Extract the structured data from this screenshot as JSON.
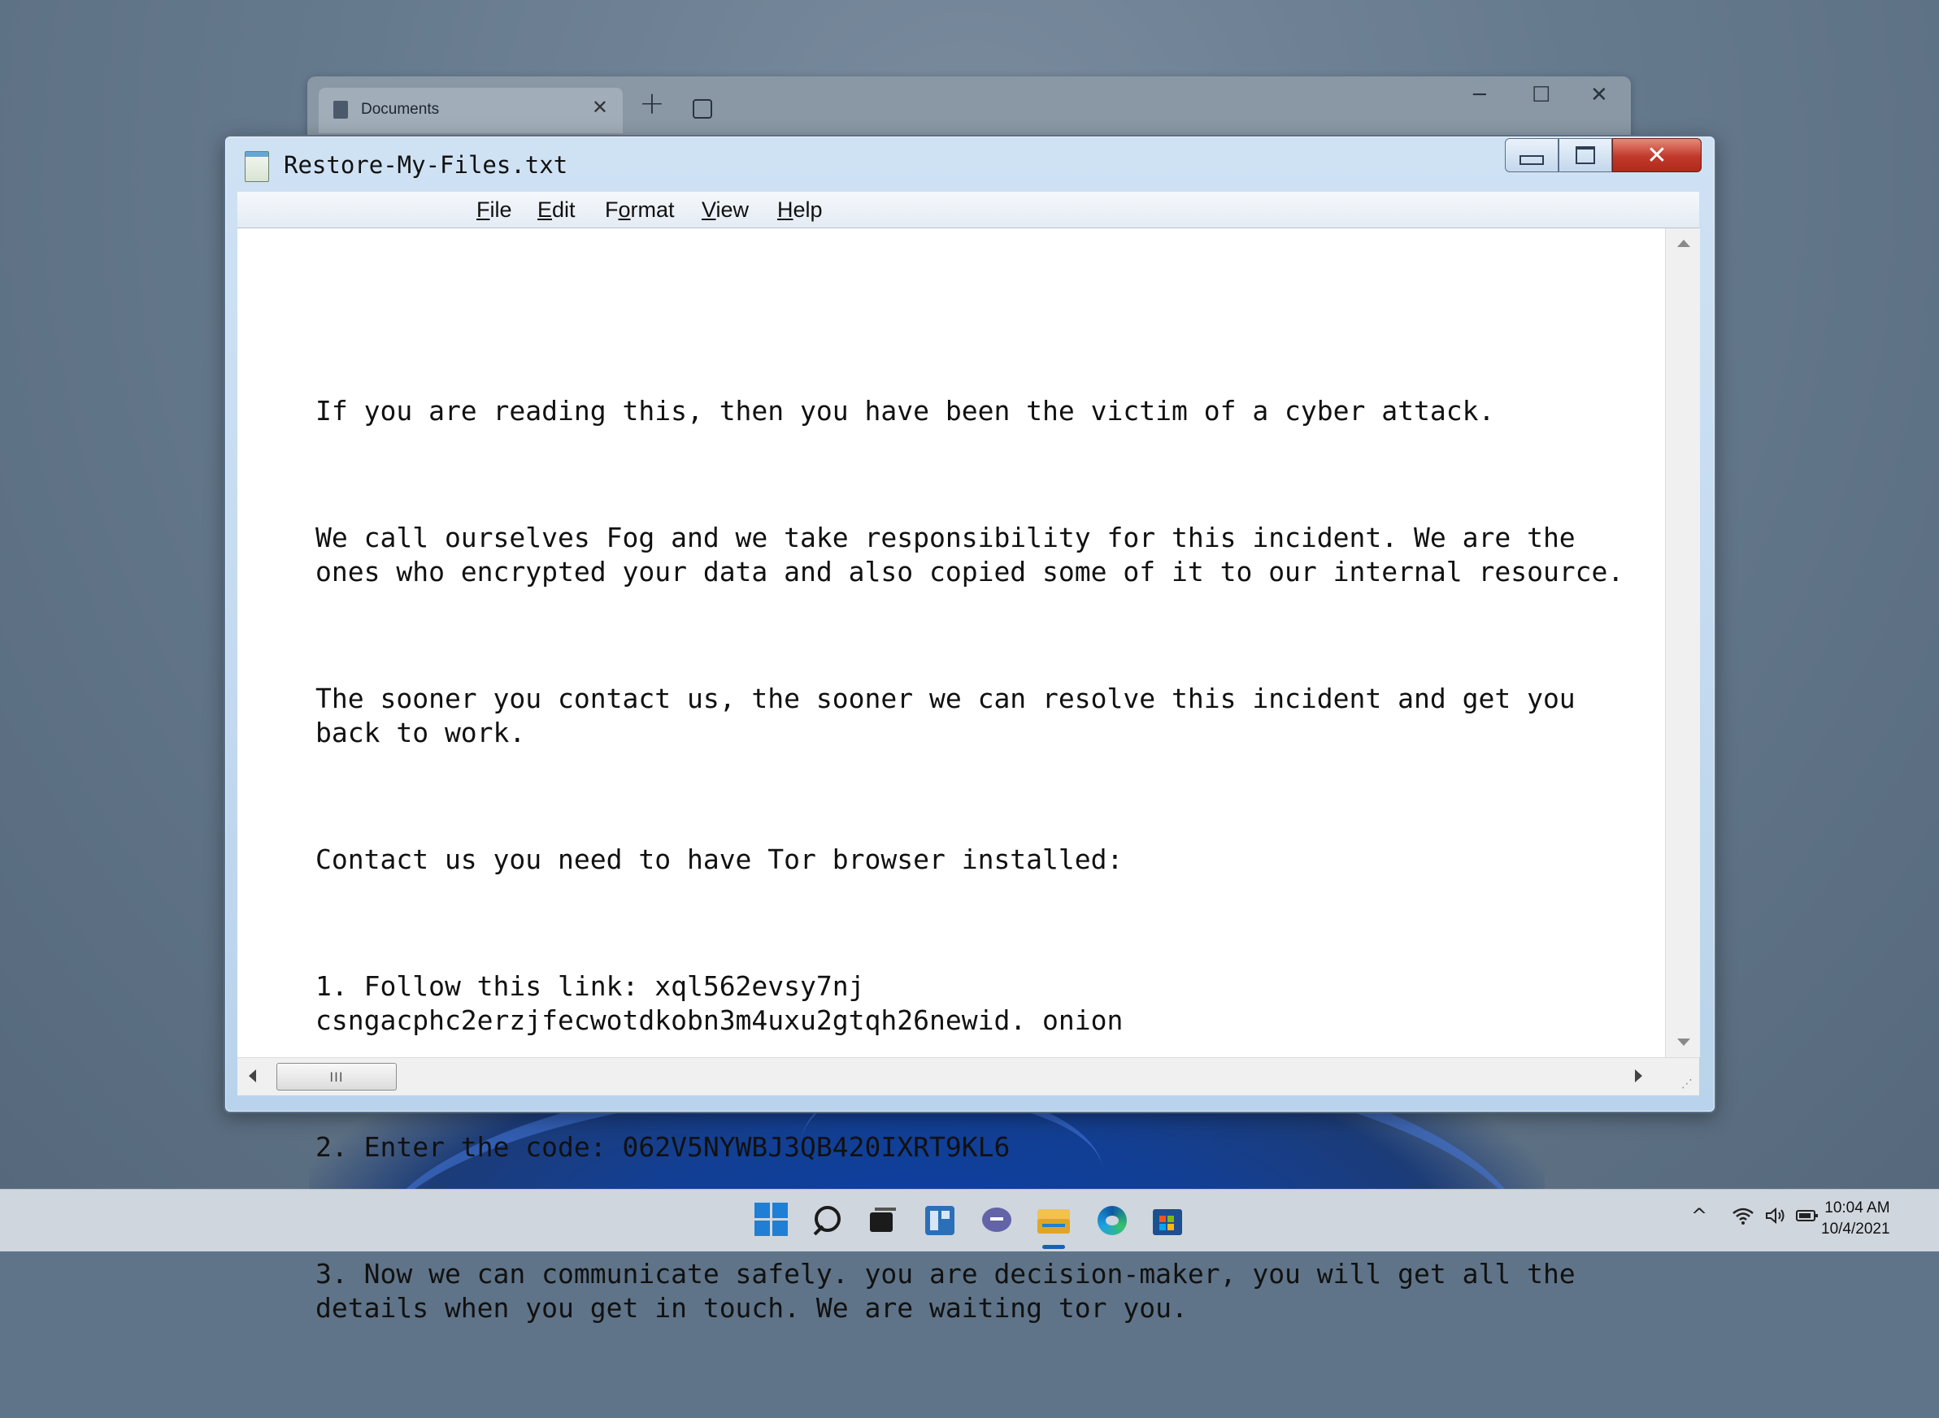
{
  "explorer": {
    "tab_label": "Documents",
    "tab_close": "✕",
    "new_tab": "+",
    "minimize": "─",
    "maximize": "☐",
    "close": "✕"
  },
  "notepad": {
    "title": "Restore-My-Files.txt",
    "menu": [
      {
        "label": "File",
        "mnemonic": "F",
        "rest": "ile"
      },
      {
        "label": "Edit",
        "mnemonic": "E",
        "rest": "dit"
      },
      {
        "label": "Format",
        "pre": "F",
        "mnemonic": "o",
        "rest": "rmat"
      },
      {
        "label": "View",
        "mnemonic": "V",
        "rest": "iew"
      },
      {
        "label": "Help",
        "mnemonic": "H",
        "rest": "elp"
      }
    ],
    "paragraphs": [
      "If you are reading this, then you have been the victim of a cyber attack.",
      "We call ourselves Fog and we take responsibility for this incident. We are the ones who encrypted your data and also copied some of it to our internal resource.",
      "The sooner you contact us, the sooner we can resolve this incident and get you back to work.",
      "Contact us you need to have Tor browser installed:",
      "1. Follow this link: xql562evsy7nj\ncsngacphc2erzjfecwotdkobn3m4uxu2gtqh26newid. onion",
      "2. Enter the code: 062V5NYWBJ3QB420IXRT9KL6",
      "3. Now we can communicate safely. you are decision-maker, you will get all the details when you get in touch. We are waiting tor you."
    ],
    "scroll_thumb_grip": "III"
  },
  "taskbar": {
    "clock_time": "10:04 AM",
    "clock_date": "10/4/2021",
    "tray_chevron": "^"
  }
}
